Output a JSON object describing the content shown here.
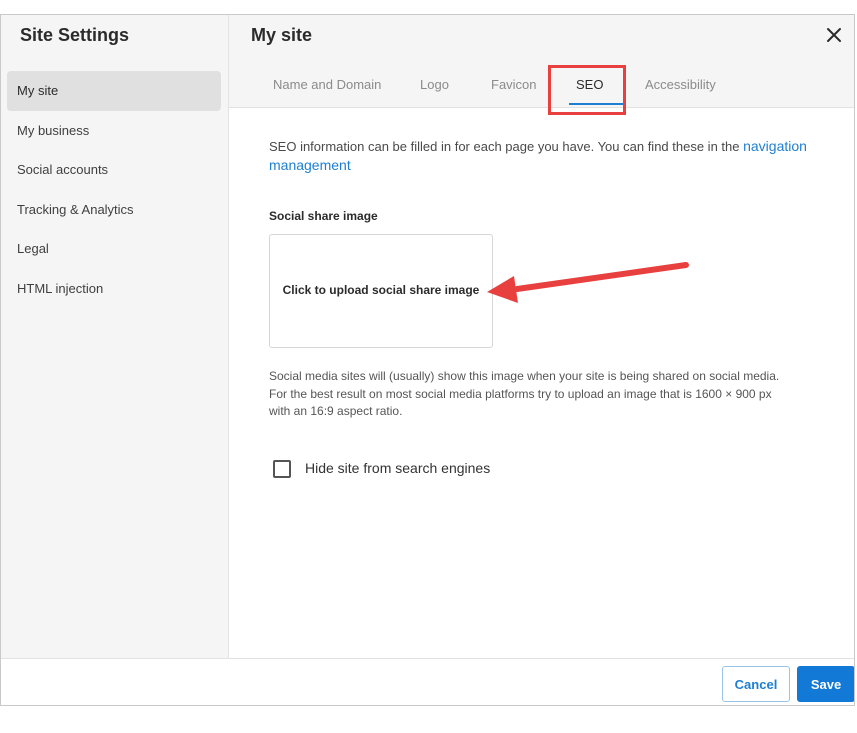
{
  "sidebar": {
    "title": "Site Settings",
    "items": [
      {
        "label": "My site",
        "active": true
      },
      {
        "label": "My business"
      },
      {
        "label": "Social accounts"
      },
      {
        "label": "Tracking & Analytics"
      },
      {
        "label": "Legal"
      },
      {
        "label": "HTML injection"
      }
    ]
  },
  "header": {
    "title": "My site",
    "close_icon": "close-icon",
    "tabs": [
      {
        "label": "Name and Domain"
      },
      {
        "label": "Logo"
      },
      {
        "label": "Favicon"
      },
      {
        "label": "SEO",
        "active": true
      },
      {
        "label": "Accessibility"
      }
    ]
  },
  "content": {
    "intro_text": "SEO information can be filled in for each page you have. You can find these in the ",
    "intro_link": "navigation management",
    "social_share_label": "Social share image",
    "upload_text": "Click to upload social share image",
    "help_lines": [
      "Social media sites will (usually) show this image when your site is being shared on social media.",
      "For the best result on most social media platforms try to upload an image that is 1600 × 900 px",
      "with an 16:9 aspect ratio."
    ],
    "hide_search_label": "Hide site from search engines",
    "hide_search_checked": false
  },
  "footer": {
    "cancel_label": "Cancel",
    "save_label": "Save"
  },
  "colors": {
    "accent": "#1e7fd1",
    "annotation": "#e8403f"
  }
}
